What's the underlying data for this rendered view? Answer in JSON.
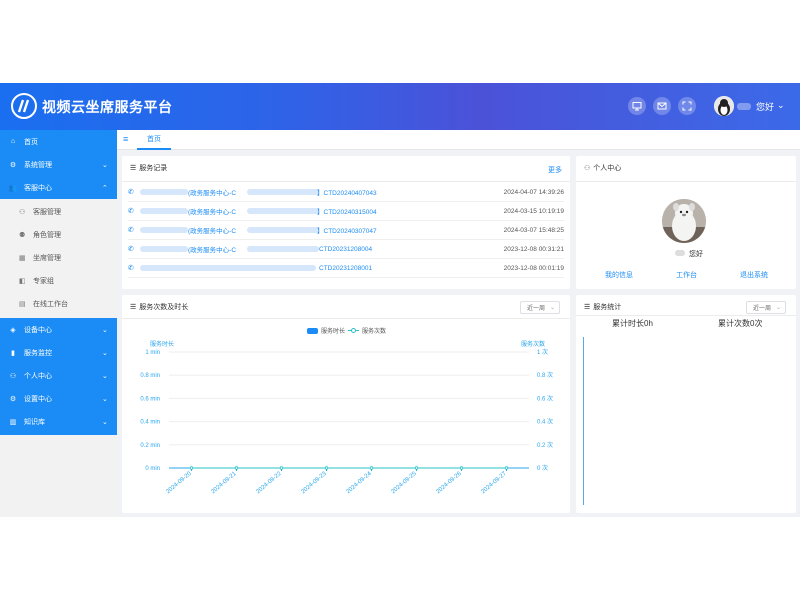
{
  "header": {
    "title": "视频云坐席服务平台",
    "greeting": "您好",
    "icons": [
      "monitor-icon",
      "mail-icon",
      "fullscreen-icon"
    ]
  },
  "sidebar": {
    "items": [
      {
        "label": "首页",
        "icon": "home-icon"
      },
      {
        "label": "系统管理",
        "icon": "gear-icon"
      },
      {
        "label": "客服中心",
        "icon": "users-icon"
      },
      {
        "label": "设备中心",
        "icon": "device-icon"
      },
      {
        "label": "服务监控",
        "icon": "bar-chart-icon"
      },
      {
        "label": "个人中心",
        "icon": "user-icon"
      },
      {
        "label": "设置中心",
        "icon": "gear-icon"
      },
      {
        "label": "知识库",
        "icon": "book-icon"
      }
    ],
    "subitems": [
      {
        "label": "客服管理",
        "icon": "user-icon"
      },
      {
        "label": "角色管理",
        "icon": "users-icon"
      },
      {
        "label": "坐席管理",
        "icon": "seat-icon"
      },
      {
        "label": "专家组",
        "icon": "badge-icon"
      },
      {
        "label": "在线工作台",
        "icon": "desk-icon"
      }
    ]
  },
  "tabs": {
    "home": "首页"
  },
  "records": {
    "title": "服务记录",
    "more": "更多",
    "rows": [
      {
        "mid": "(政务服务中心-C",
        "code": "】CTD20240407043",
        "time": "2024-04-07 14:39:26"
      },
      {
        "mid": "(政务服务中心-C",
        "code": "】CTD20240315004",
        "time": "2024-03-15 10:19:19"
      },
      {
        "mid": "(政务服务中心-C",
        "code": "】CTD20240307047",
        "time": "2024-03-07 15:48:25"
      },
      {
        "mid": "(政务服务中心-C",
        "code": "CTD20231208004",
        "time": "2023-12-08 00:31:21"
      },
      {
        "mid": "",
        "code": "CTD20231208001",
        "time": "2023-12-08 00:01:19"
      }
    ]
  },
  "personal": {
    "title": "个人中心",
    "greeting": "您好",
    "links": [
      "我的信息",
      "工作台",
      "退出系统"
    ]
  },
  "service_chart": {
    "title": "服务次数及时长",
    "range": "近一周"
  },
  "service_stats": {
    "title": "服务统计",
    "range": "近一周",
    "duration_label": "累计时长0h",
    "count_label": "累计次数0次"
  },
  "colors": {
    "accent": "#1b8cf5",
    "line": "#2ac3c8"
  },
  "chart_data": {
    "type": "line",
    "x": [
      "2024-09-20",
      "2024-09-21",
      "2024-09-22",
      "2024-09-23",
      "2024-09-24",
      "2024-09-25",
      "2024-09-26",
      "2024-09-27"
    ],
    "series": [
      {
        "name": "服务时长",
        "values": [
          0,
          0,
          0,
          0,
          0,
          0,
          0,
          0
        ]
      },
      {
        "name": "服务次数",
        "values": [
          0,
          0,
          0,
          0,
          0,
          0,
          0,
          0
        ]
      }
    ],
    "ylabel": "服务时长",
    "y2label": "服务次数",
    "yticks": [
      "1 min",
      "0.8 min",
      "0.6 min",
      "0.4 min",
      "0.2 min",
      "0 min"
    ],
    "y2ticks": [
      "1 次",
      "0.8 次",
      "0.6 次",
      "0.4 次",
      "0.2 次",
      "0 次"
    ],
    "ylim": [
      0,
      1
    ],
    "y2lim": [
      0,
      1
    ],
    "legend": "top-center",
    "grid": true
  }
}
